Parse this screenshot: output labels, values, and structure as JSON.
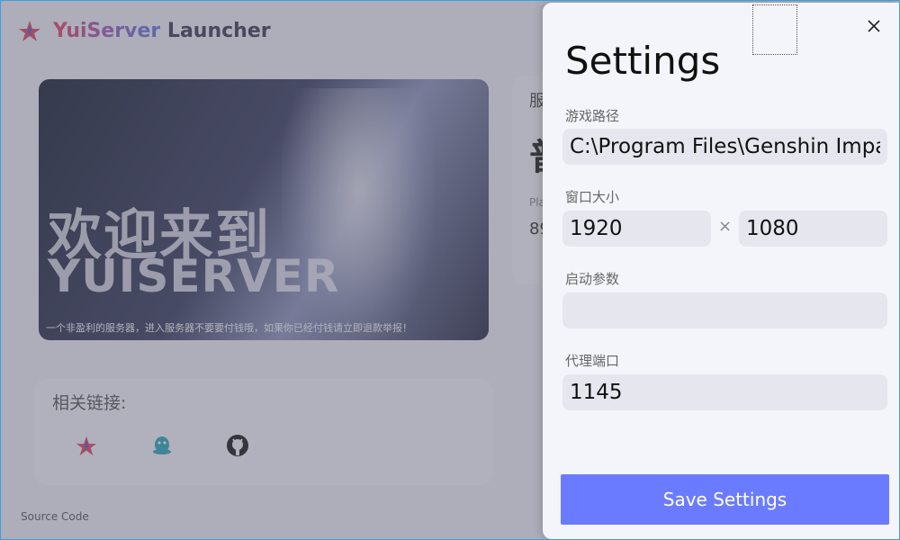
{
  "app": {
    "brand": "YuiServer",
    "title_rest": " Launcher"
  },
  "banner": {
    "welcome": "欢迎来到",
    "server_name": "YUISERVER",
    "notice": "一个非盈利的服务器，进入服务器不要要付钱哦，如果你已经付钱请立即退款举报！"
  },
  "status_card": {
    "label": "服",
    "big": "普",
    "players_label": "Pla",
    "players_value": "89"
  },
  "links": {
    "title": "相关链接:",
    "icons": [
      "yuiserver-logo-icon",
      "qq-icon",
      "github-icon"
    ]
  },
  "footer": {
    "source_code": "Source Code"
  },
  "settings": {
    "title": "Settings",
    "game_path_label": "游戏路径",
    "game_path_value": "C:\\Program Files\\Genshin Impact",
    "window_size_label": "窗口大小",
    "width_value": "1920",
    "times": "×",
    "height_value": "1080",
    "launch_args_label": "启动参数",
    "launch_args_value": "",
    "proxy_port_label": "代理端口",
    "proxy_port_value": "1145",
    "save_label": "Save Settings"
  },
  "colors": {
    "accent": "#6b7bff",
    "brand_start": "#e0455d",
    "brand_end": "#5b7bd6"
  }
}
